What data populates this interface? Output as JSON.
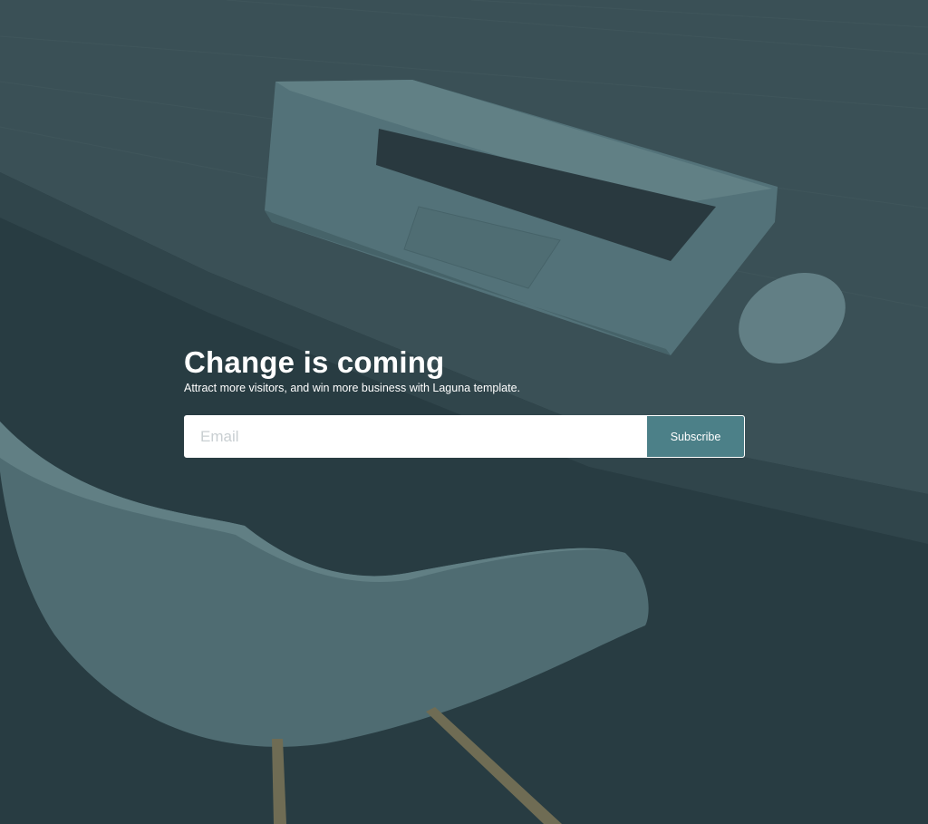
{
  "hero": {
    "title": "Change is coming",
    "subtitle": "Attract more visitors, and win more business with Laguna template."
  },
  "form": {
    "email_placeholder": "Email",
    "email_value": "",
    "subscribe_label": "Subscribe"
  },
  "colors": {
    "overlay": "#2a3e44",
    "accent": "#4c8088",
    "text": "#ffffff"
  }
}
